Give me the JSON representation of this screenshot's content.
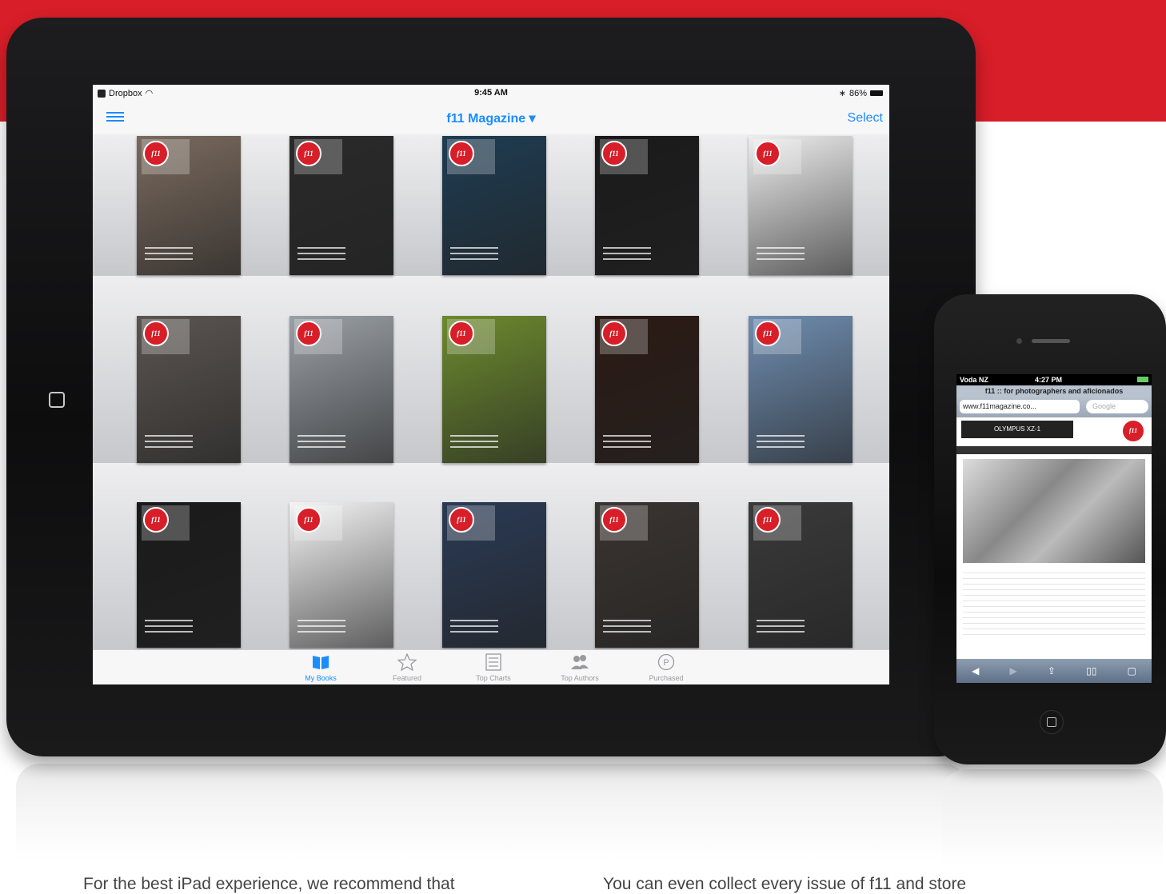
{
  "colors": {
    "brand_red": "#d81e28",
    "ios_blue": "#1a8cff",
    "device_black": "#111111"
  },
  "ipad": {
    "status": {
      "carrier": "Dropbox",
      "time": "9:45 AM",
      "battery": "86%"
    },
    "nav": {
      "title": "f11 Magazine ▾",
      "select": "Select",
      "menu_icon": "list-icon"
    },
    "tabs": [
      {
        "label": "My Books",
        "icon": "book-icon",
        "active": true
      },
      {
        "label": "Featured",
        "icon": "star-icon",
        "active": false
      },
      {
        "label": "Top Charts",
        "icon": "list-icon",
        "active": false
      },
      {
        "label": "Top Authors",
        "icon": "people-icon",
        "active": false
      },
      {
        "label": "Purchased",
        "icon": "purchased-icon",
        "active": false
      }
    ],
    "covers": [
      {
        "row": 0,
        "col": 0,
        "logo": "f11",
        "color": "#7a6a5e"
      },
      {
        "row": 0,
        "col": 1,
        "logo": "f11",
        "color": "#2a2a2a"
      },
      {
        "row": 0,
        "col": 2,
        "logo": "f11",
        "color": "#1e3c52"
      },
      {
        "row": 0,
        "col": 3,
        "logo": "f11",
        "color": "#1a1a1a"
      },
      {
        "row": 0,
        "col": 4,
        "logo": "f11",
        "color": "#eeeeee"
      },
      {
        "row": 1,
        "col": 0,
        "logo": "f11",
        "color": "#5b5551"
      },
      {
        "row": 1,
        "col": 1,
        "logo": "f11",
        "color": "#9aa0a6"
      },
      {
        "row": 1,
        "col": 2,
        "logo": "f11",
        "color": "#6c8a2e"
      },
      {
        "row": 1,
        "col": 3,
        "logo": "f11",
        "color": "#2b1a14"
      },
      {
        "row": 1,
        "col": 4,
        "logo": "f11",
        "color": "#6f8db0"
      },
      {
        "row": 2,
        "col": 0,
        "logo": "f11",
        "color": "#1a1a1a"
      },
      {
        "row": 2,
        "col": 1,
        "logo": "f11",
        "color": "#f4f4f4"
      },
      {
        "row": 2,
        "col": 2,
        "logo": "f11",
        "color": "#2a3a55"
      },
      {
        "row": 2,
        "col": 3,
        "logo": "f11",
        "color": "#3a3430"
      },
      {
        "row": 2,
        "col": 4,
        "logo": "f11",
        "color": "#3a3a3a"
      }
    ]
  },
  "iphone": {
    "status": {
      "carrier": "Voda NZ",
      "time": "4:27 PM"
    },
    "page_title": "f11 :: for photographers and aficionados",
    "url": "www.f11magazine.co...",
    "search_placeholder": "Google",
    "ad_text": "OLYMPUS XZ-1",
    "logo": "f11"
  },
  "bottom_text": {
    "left": "For the best iPad experience, we recommend that",
    "right": "You can even collect every issue of f11 and store"
  }
}
